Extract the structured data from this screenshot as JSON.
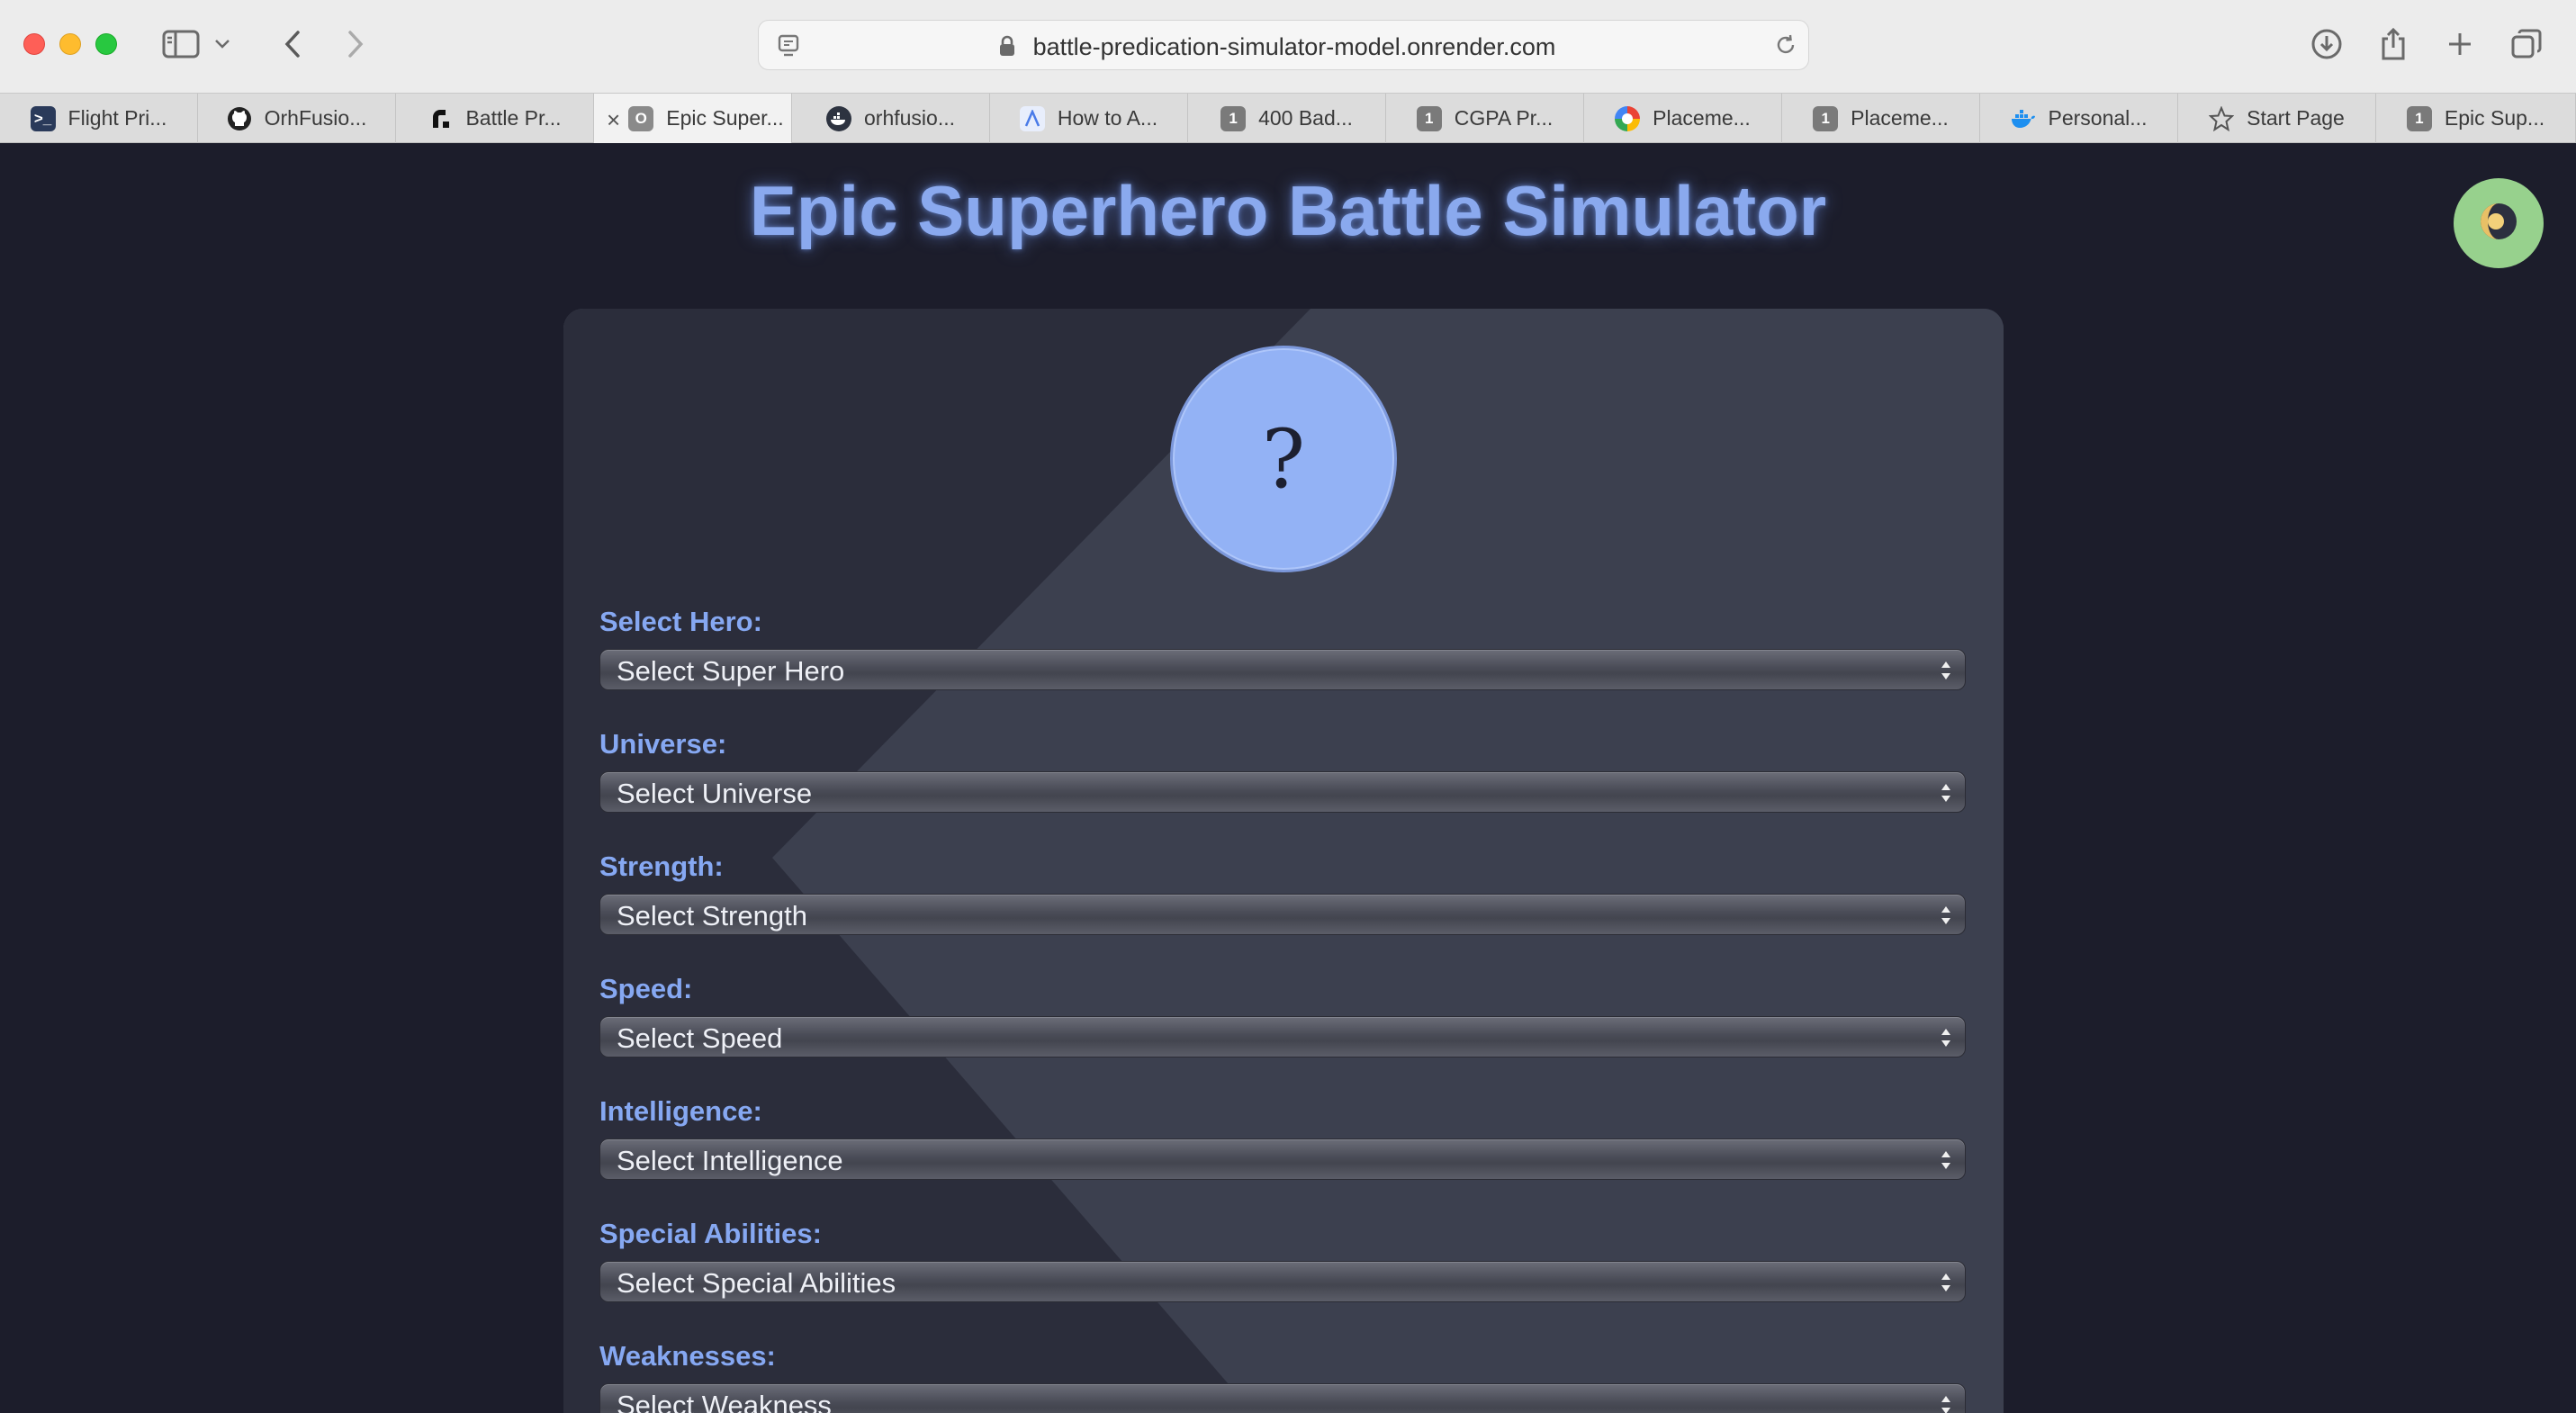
{
  "browser": {
    "url": "battle-predication-simulator-model.onrender.com",
    "tabs": [
      {
        "label": "Flight Pri...",
        "icon": "terminal-icon"
      },
      {
        "label": "OrhFusio...",
        "icon": "github-icon"
      },
      {
        "label": "Battle Pr...",
        "icon": "render-icon"
      },
      {
        "label": "Epic Super...",
        "icon": "page-o-icon",
        "active": true
      },
      {
        "label": "orhfusio...",
        "icon": "docker-hub-icon"
      },
      {
        "label": "How to A...",
        "icon": "a-icon"
      },
      {
        "label": "400 Bad...",
        "icon": "badge-1-icon"
      },
      {
        "label": "CGPA Pr...",
        "icon": "badge-1-icon"
      },
      {
        "label": "Placeme...",
        "icon": "color-wheel-icon"
      },
      {
        "label": "Placeme...",
        "icon": "badge-1-icon"
      },
      {
        "label": "Personal...",
        "icon": "docker-icon"
      },
      {
        "label": "Start Page",
        "icon": "star-icon"
      },
      {
        "label": "Epic Sup...",
        "icon": "badge-1-icon"
      }
    ]
  },
  "page": {
    "title": "Epic Superhero Battle Simulator",
    "avatar_glyph": "?",
    "theme_toggle_icon": "moon-sun-icon",
    "fields": [
      {
        "label": "Select Hero:",
        "placeholder": "Select Super Hero"
      },
      {
        "label": "Universe:",
        "placeholder": "Select Universe"
      },
      {
        "label": "Strength:",
        "placeholder": "Select Strength"
      },
      {
        "label": "Speed:",
        "placeholder": "Select Speed"
      },
      {
        "label": "Intelligence:",
        "placeholder": "Select Intelligence"
      },
      {
        "label": "Special Abilities:",
        "placeholder": "Select Special Abilities"
      },
      {
        "label": "Weaknesses:",
        "placeholder": "Select Weakness"
      }
    ]
  },
  "colors": {
    "page_bg": "#1c1d2b",
    "panel_bg": "#3a3e4d",
    "accent": "#86a8f2",
    "avatar": "#93b2f5",
    "theme_toggle": "#97d18d"
  }
}
